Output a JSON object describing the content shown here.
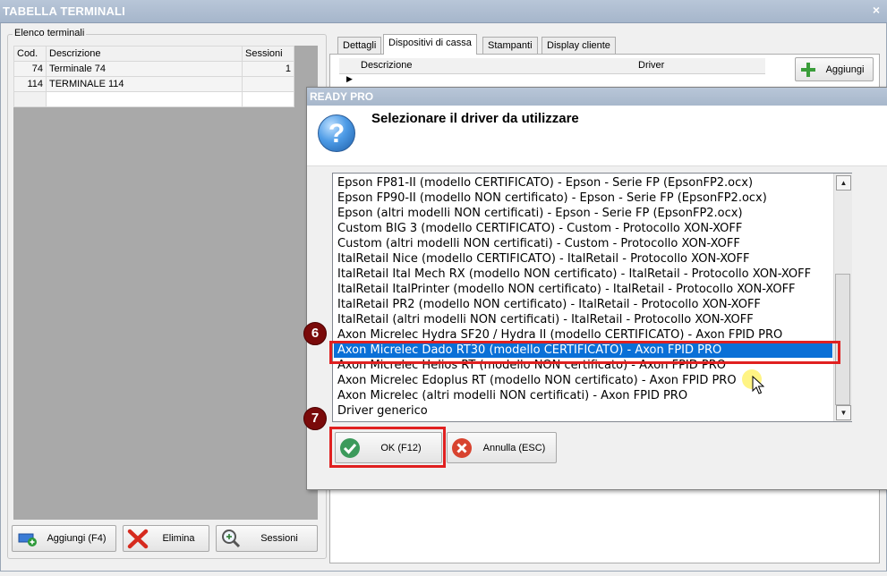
{
  "window": {
    "title": "TABELLA TERMINALI",
    "close_glyph": "×"
  },
  "terminals": {
    "legend": "Elenco terminali",
    "columns": [
      "Cod.",
      "Descrizione",
      "Sessioni"
    ],
    "rows": [
      {
        "cod": "74",
        "desc": "Terminale 74",
        "sessioni": "1"
      },
      {
        "cod": "114",
        "desc": "TERMINALE 114",
        "sessioni": ""
      }
    ],
    "buttons": {
      "add": "Aggiungi (F4)",
      "delete": "Elimina",
      "sessions": "Sessioni"
    }
  },
  "tabs": [
    "Dettagli",
    "Dispositivi di cassa",
    "Stampanti",
    "Display cliente"
  ],
  "devices": {
    "columns": [
      "Descrizione",
      "Driver"
    ],
    "add_button": "Aggiungi"
  },
  "dialog": {
    "title": "READY PRO",
    "message": "Selezionare il driver da utilizzare",
    "icon": "question-icon",
    "drivers": [
      "Epson FP81-II (modello CERTIFICATO) - Epson - Serie FP (EpsonFP2.ocx)",
      "Epson FP90-II (modello NON certificato) - Epson - Serie FP (EpsonFP2.ocx)",
      "Epson (altri modelli NON certificati) - Epson - Serie FP (EpsonFP2.ocx)",
      "Custom BIG 3 (modello CERTIFICATO) - Custom - Protocollo XON-XOFF",
      "Custom (altri modelli NON certificati) - Custom - Protocollo XON-XOFF",
      "ItalRetail Nice (modello CERTIFICATO) - ItalRetail - Protocollo XON-XOFF",
      "ItalRetail Ital Mech RX (modello NON certificato) - ItalRetail - Protocollo XON-XOFF",
      "ItalRetail ItalPrinter (modello NON certificato) - ItalRetail - Protocollo XON-XOFF",
      "ItalRetail PR2 (modello NON certificato) - ItalRetail - Protocollo XON-XOFF",
      "ItalRetail (altri modelli NON certificati) - ItalRetail - Protocollo XON-XOFF",
      "Axon Micrelec Hydra SF20 / Hydra II (modello CERTIFICATO) - Axon FPID PRO",
      "Axon Micrelec Dado RT30 (modello CERTIFICATO) - Axon FPID PRO",
      "Axon Micrelec Helios RT (modello NON certificato) - Axon FPID PRO",
      "Axon Micrelec Edoplus RT (modello NON certificato) - Axon FPID PRO",
      "Axon Micrelec (altri modelli NON certificati) - Axon FPID PRO",
      "Driver generico"
    ],
    "selected_index": 11,
    "ok_label": "OK (F12)",
    "cancel_label": "Annulla (ESC)"
  },
  "annotations": {
    "step_select": "6",
    "step_ok": "7"
  },
  "colors": {
    "selection": "#0a70d7",
    "highlight": "#e02020",
    "callout": "#7a0a0a"
  }
}
